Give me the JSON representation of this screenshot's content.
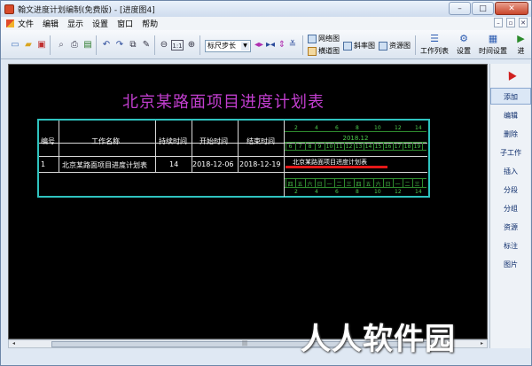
{
  "window": {
    "title": "翰文进度计划编制(免费版) - [进度图4]"
  },
  "menu": {
    "items": [
      "文件",
      "编辑",
      "显示",
      "设置",
      "窗口",
      "帮助"
    ]
  },
  "toolbar": {
    "ruler_select": "标尺步长",
    "view_buttons": [
      "网络图",
      "横道图",
      "斜率图",
      "资源图"
    ],
    "big_buttons": [
      "工作列表",
      "设置",
      "时间设置",
      "进"
    ]
  },
  "chart": {
    "title": "北京某路面项目进度计划表",
    "headers": {
      "id": "编号",
      "name": "工作名称",
      "duration": "持续时间",
      "start": "开始时间",
      "end": "结束时间"
    },
    "row": {
      "id": "1",
      "name": "北京某路面项目进度计划表",
      "duration": "14",
      "start": "2018-12-06",
      "end": "2018-12-19"
    },
    "timeline": {
      "top_days": [
        "2",
        "4",
        "6",
        "8",
        "10",
        "12",
        "14"
      ],
      "month": "2018.12",
      "dates": [
        "6",
        "7",
        "8",
        "9",
        "10",
        "11",
        "12",
        "13",
        "14",
        "15",
        "16",
        "17",
        "18",
        "19"
      ],
      "bar_label": "北京某路面项目进度计划表",
      "weekdays": [
        "四",
        "五",
        "六",
        "日",
        "一",
        "二",
        "三",
        "四",
        "五",
        "六",
        "日",
        "一",
        "二",
        "三"
      ],
      "bottom_days": [
        "2",
        "4",
        "6",
        "8",
        "10",
        "12",
        "14"
      ]
    }
  },
  "right_panel": {
    "items": [
      "添加",
      "编辑",
      "删除",
      "子工作",
      "插入",
      "分段",
      "分组",
      "资源",
      "标注",
      "图片"
    ]
  },
  "watermark": "人人软件园"
}
